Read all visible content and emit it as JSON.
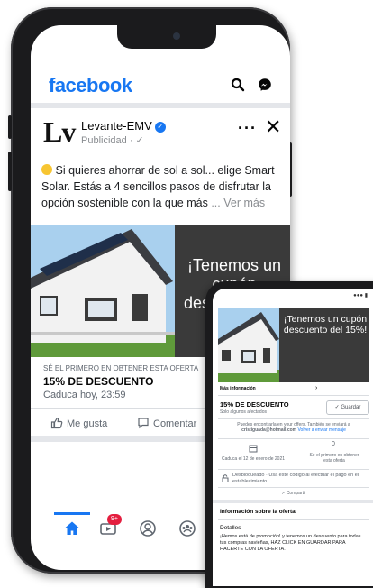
{
  "facebook": {
    "logo": "facebook",
    "header_icons": [
      "search-icon",
      "messenger-icon"
    ],
    "post": {
      "page_name": "Levante-EMV",
      "logo_text": "Lv",
      "verified_mark": "✓",
      "sponsored": "Publicidad · ✓",
      "more": "···",
      "close": "✕",
      "text": "Si quieres ahorrar de sol a sol... elige Smart Solar. Estás a 4 sencillos pasos de disfrutar la opción sostenible con la que más",
      "see_more": "... Ver más",
      "ad_headline": "¡Tenemos un cupón descuento del 15%!",
      "offer_label": "SÉ EL PRIMERO EN OBTENER ESTA OFERTA",
      "offer_title": "15% DE DESCUENTO",
      "offer_expiry": "Caduca hoy, 23:59",
      "like_label": "Me gusta",
      "comment_label": "Comentar"
    },
    "bottom_nav": {
      "items": [
        "home-icon",
        "video-icon",
        "profile-icon",
        "groups-icon"
      ],
      "video_badge": "9+"
    }
  },
  "second_screen": {
    "status": "●●● ▮",
    "ad_headline": "¡Tenemos un cupón descuento del 15%!",
    "more_info": "Más información",
    "offer_title": "15% DE DESCUENTO",
    "offer_subtitle": "Solo algunos afectados",
    "save_label": "Guardar",
    "email_line1": "Puedes encontrarla en your offers. También se enviará a",
    "email_address": "cristiguada@hotmail.com",
    "email_link": "Volver a enviar mensaje",
    "expiry": "Caduca el 12 de enero de 2021",
    "claimed_count": "0",
    "claimed_text": "Sé el primero en obtener esta oferta",
    "shop_text": "Desbloqueado · Usa este código al efectuar el pago en el establecimiento.",
    "share": "Compartir",
    "info_header": "Información sobre la oferta",
    "details_header": "Detalles",
    "details_text": "¡Hemos está de promoción! y tenemos un descuento para todas tus compras navieñas, HAZ CLICK EN GUARDAR PARA HACERTE CON LA OFERTA."
  },
  "colors": {
    "facebook_blue": "#1877f2",
    "ad_panel": "#3a3a3a",
    "badge_red": "#e41e3f"
  }
}
